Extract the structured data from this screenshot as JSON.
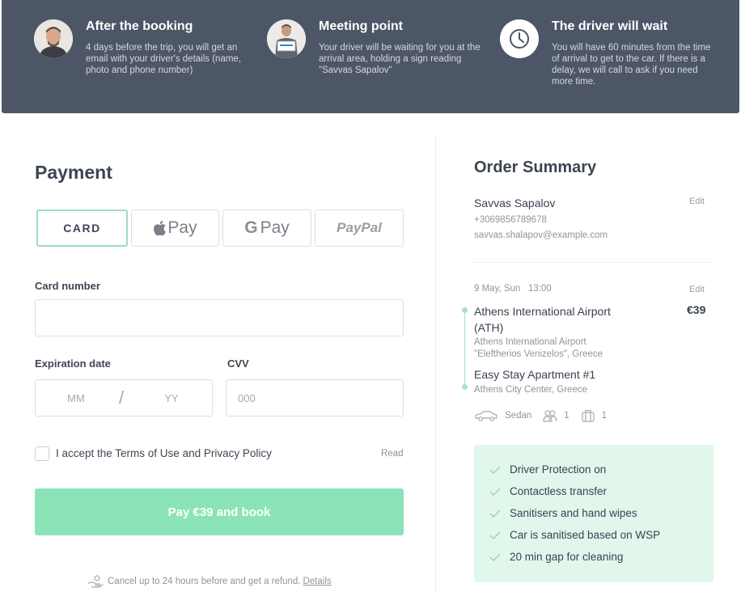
{
  "banner": {
    "features": [
      {
        "title": "After the booking",
        "description": "4 days before the trip, you will get an email with your driver's details (name, photo and phone number)",
        "icon": "driver-photo"
      },
      {
        "title": "Meeting point",
        "description": "Your driver will be waiting for you at the arrival area, holding a sign reading \"Savvas Sapalov\"",
        "icon": "driver-with-sign-photo"
      },
      {
        "title": "The driver will wait",
        "description": "You will have 60 minutes from the time of arrival to get to the car. If there is a delay, we will call to ask if you need more time.",
        "icon": "clock-icon"
      }
    ],
    "background": "#4d5666"
  },
  "payment": {
    "title": "Payment",
    "methods": [
      {
        "label": "CARD",
        "active": true
      },
      {
        "label": "Pay",
        "brand": "apple-icon"
      },
      {
        "label": "Pay",
        "brand": "G"
      },
      {
        "label": "PayPal"
      }
    ],
    "card_number": {
      "label": "Card number",
      "value": "",
      "placeholder": ""
    },
    "expiration": {
      "label": "Expiration date",
      "mm_placeholder": "MM",
      "yy_placeholder": "YY",
      "separator": "/"
    },
    "cvv": {
      "label": "CVV",
      "placeholder": "000"
    },
    "terms": {
      "text": "I accept the Terms of Use and Privacy Policy",
      "read_label": "Read",
      "checked": false
    },
    "pay_button": {
      "label": "Pay €39 and book",
      "color": "#8be4b8"
    },
    "refund": {
      "text": "Cancel up to 24 hours before and get a refund.",
      "link": "Details"
    }
  },
  "summary": {
    "title": "Order Summary",
    "customer": {
      "name": "Savvas Sapalov",
      "phone": "+3069856789678",
      "email": "savvas.shalapov@example.com",
      "edit_label": "Edit"
    },
    "trip": {
      "date": "9 May, Sun   13:00",
      "edit_label": "Edit",
      "from_name": "Athens International Airport (ATH)",
      "from_address": "Athens International Airport \"Eleftherios Venizelos\", Greece",
      "price": "€39",
      "to_name": "Easy Stay Apartment #1",
      "to_address": "Athens City Center, Greece",
      "vehicle": "Sedan",
      "passengers": "1",
      "luggage": "1"
    },
    "safety": {
      "items": [
        "Driver Protection on",
        "Contactless transfer",
        "Sanitisers and hand wipes",
        "Car is sanitised based on WSP",
        "20 min gap for cleaning"
      ],
      "background": "#e2f7ec",
      "check_color": "#8fd9b6"
    }
  }
}
